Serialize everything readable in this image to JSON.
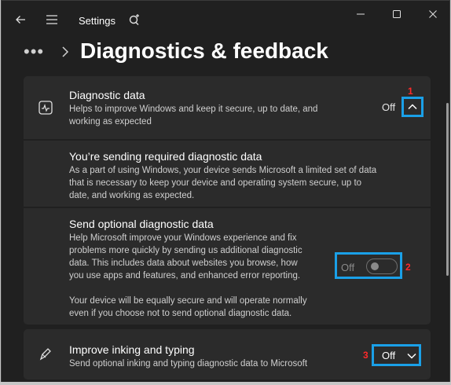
{
  "window": {
    "app_title": "Settings"
  },
  "breadcrumb": {
    "more": "•••",
    "page_title": "Diagnostics & feedback"
  },
  "diagnostic_data": {
    "title": "Diagnostic data",
    "description_line1": "Helps to improve Windows and keep it secure, up to date, and",
    "description_line2": "working as expected",
    "state": "Off",
    "marker": "1"
  },
  "required_data": {
    "title": "You’re sending required diagnostic data",
    "description_line1": "As a part of using Windows, your device sends Microsoft a limited set of data",
    "description_line2": "that is necessary to keep your device and operating system secure, up to",
    "description_line3": "date, and working as expected."
  },
  "optional_data": {
    "title": "Send optional diagnostic data",
    "description_line1": "Help Microsoft improve your Windows experience and fix",
    "description_line2": "problems more quickly by sending us additional diagnostic",
    "description_line3": "data. This includes data about websites you browse, how",
    "description_line4": "you use apps and features, and enhanced error reporting.",
    "note_line1": "Your device will be equally secure and will operate normally",
    "note_line2": "even if you choose not to send optional diagnostic data.",
    "toggle_label": "Off",
    "toggle_on": false,
    "marker": "2"
  },
  "inking": {
    "title": "Improve inking and typing",
    "description": "Send optional inking and typing diagnostic data to Microsoft",
    "state": "Off",
    "marker": "3"
  },
  "colors": {
    "highlight_box": "#1aa0e8",
    "marker": "#ff2a2a",
    "background": "#202020",
    "card": "#2b2b2b"
  },
  "icons": {
    "back": "back-arrow-icon",
    "menu": "hamburger-menu-icon",
    "app": "settings-sparkle-icon",
    "minimize": "minimize-icon",
    "maximize": "maximize-icon",
    "close": "close-icon",
    "diagnostic": "activity-chart-icon",
    "inking": "pen-icon",
    "collapse": "chevron-up-icon",
    "expand": "chevron-down-icon"
  }
}
